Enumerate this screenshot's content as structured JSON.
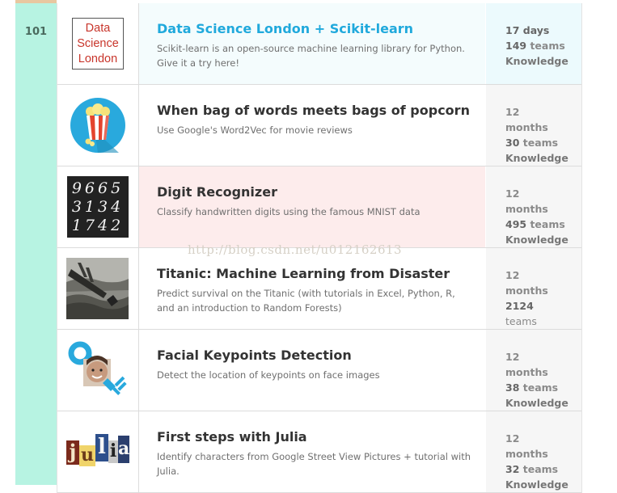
{
  "rank": "101",
  "watermark": "http://blog.csdn.net/u012162613",
  "competitions": [
    {
      "title": "Data Science London + Scikit-learn",
      "description": "Scikit-learn is an open-source machine learning library for Python. Give it a try here!",
      "meta": [
        "17 days",
        "149",
        "teams",
        "Knowledge"
      ],
      "logo_text": [
        "Data",
        "Science",
        "London"
      ],
      "logo": "data-science-london-logo"
    },
    {
      "title": "When bag of words meets bags of popcorn",
      "description": "Use Google's Word2Vec for movie reviews",
      "meta": [
        "12",
        "months",
        "30",
        "teams",
        "Knowledge"
      ],
      "logo": "popcorn-icon"
    },
    {
      "title": "Digit Recognizer",
      "description": "Classify handwritten digits using the famous MNIST data",
      "meta": [
        "12",
        "months",
        "495",
        "teams",
        "Knowledge"
      ],
      "logo": "handwritten-digits-thumbnail",
      "logo_text": [
        "9665",
        "3134",
        "1742"
      ]
    },
    {
      "title": "Titanic: Machine Learning from Disaster",
      "description": "Predict survival on the Titanic (with tutorials in Excel, Python, R, and an introduction to Random Forests)",
      "meta": [
        "12",
        "months",
        "2124",
        "teams"
      ],
      "logo": "titanic-thumbnail"
    },
    {
      "title": "Facial Keypoints Detection",
      "description": "Detect the location of keypoints on face images",
      "meta": [
        "12",
        "months",
        "38",
        "teams",
        "Knowledge"
      ],
      "logo": "face-keypoints-icon"
    },
    {
      "title": "First steps with Julia",
      "description": "Identify characters from Google Street View Pictures + tutorial with Julia.",
      "meta": [
        "12",
        "months",
        "32",
        "teams",
        "Knowledge"
      ],
      "logo": "julia-thumbnail",
      "logo_text": [
        "j",
        "u",
        "l",
        "i",
        "a"
      ]
    }
  ],
  "colors": {
    "rank_column": "#b7f3e2",
    "link_title": "#20a9dc",
    "highlight_blue": "#f4fcfd",
    "highlight_pink": "#fdecec"
  }
}
